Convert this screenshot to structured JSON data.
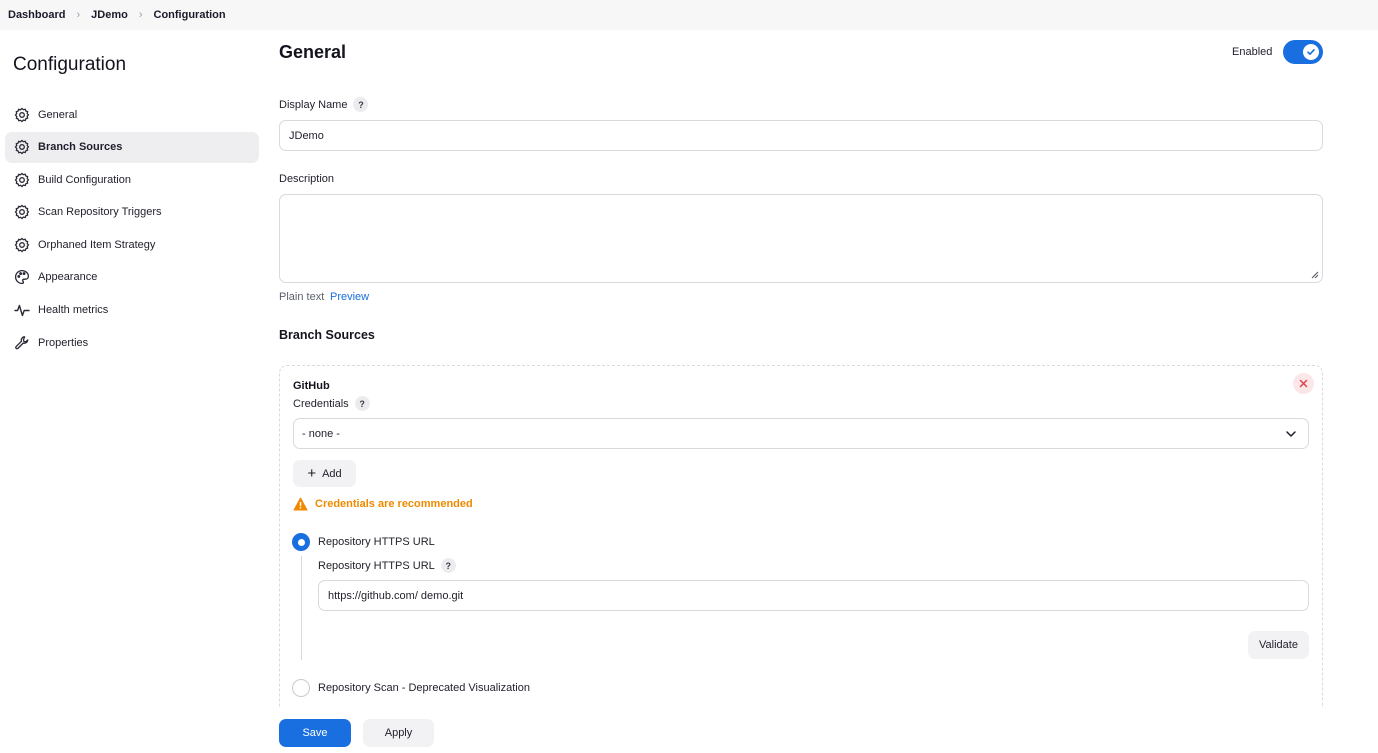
{
  "breadcrumb": {
    "items": [
      "Dashboard",
      "JDemo",
      "Configuration"
    ]
  },
  "sidebar": {
    "title": "Configuration",
    "items": [
      {
        "label": "General",
        "icon": "gear-icon",
        "active": false
      },
      {
        "label": "Branch Sources",
        "icon": "gear-icon",
        "active": true
      },
      {
        "label": "Build Configuration",
        "icon": "gear-icon",
        "active": false
      },
      {
        "label": "Scan Repository Triggers",
        "icon": "gear-icon",
        "active": false
      },
      {
        "label": "Orphaned Item Strategy",
        "icon": "gear-icon",
        "active": false
      },
      {
        "label": "Appearance",
        "icon": "palette-icon",
        "active": false
      },
      {
        "label": "Health metrics",
        "icon": "pulse-icon",
        "active": false
      },
      {
        "label": "Properties",
        "icon": "wrench-icon",
        "active": false
      }
    ]
  },
  "general": {
    "heading": "General",
    "enabled_label": "Enabled",
    "enabled": true,
    "display_name_label": "Display Name",
    "display_name_value": "JDemo",
    "description_label": "Description",
    "description_value": "",
    "plain_text": "Plain text",
    "preview": "Preview"
  },
  "branch_sources": {
    "heading": "Branch Sources",
    "github": {
      "title": "GitHub",
      "credentials_label": "Credentials",
      "credentials_selected": "- none -",
      "add_label": "Add",
      "warning": "Credentials are recommended",
      "radio_https_label": "Repository HTTPS URL",
      "https_url_label": "Repository HTTPS URL",
      "https_url_value": "https://github.com/            demo.git",
      "validate_label": "Validate",
      "radio_scan_label": "Repository Scan - Deprecated Visualization"
    }
  },
  "actions": {
    "save": "Save",
    "apply": "Apply"
  },
  "help_glyph": "?",
  "colors": {
    "accent": "#1a6fe0",
    "warning": "#f08a00",
    "danger": "#e0444c"
  }
}
